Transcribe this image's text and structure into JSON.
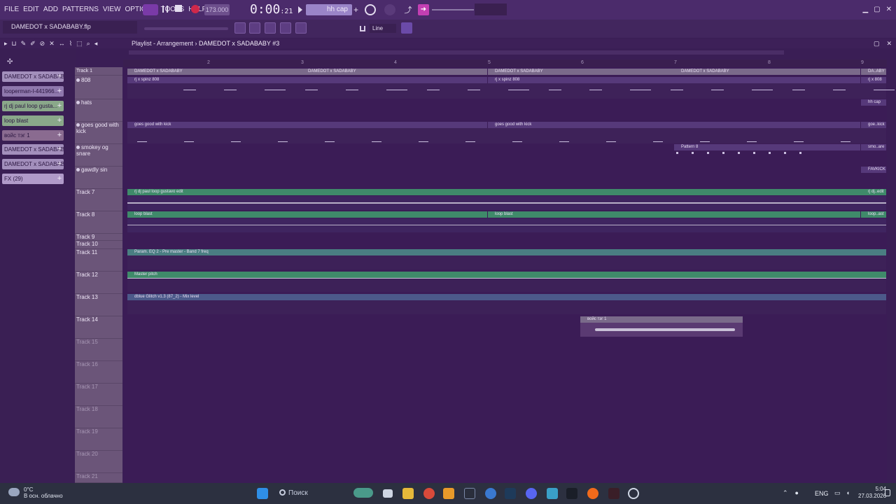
{
  "menu": [
    "FILE",
    "EDIT",
    "ADD",
    "PATTERNS",
    "VIEW",
    "OPTIONS",
    "TOOLS",
    "HELP"
  ],
  "transport": {
    "bpm": "173.000",
    "time_main": "0:00",
    "time_sub": "21",
    "pattern": "hh cap"
  },
  "hint_bar": "DAMEDOT x SADABABY.flp",
  "snap": "Line",
  "playlist": {
    "title": "Playlist - Arrangement",
    "arrangement": "DAMEDOT x SADABABY #3"
  },
  "ruler_marks": [
    "2",
    "3",
    "4",
    "5",
    "6",
    "7",
    "8",
    "9"
  ],
  "picker": [
    {
      "label": "DAMEDOT x SADABAB..",
      "color": "#a38fbc"
    },
    {
      "label": "looperman-l-441966...",
      "color": "#8f78ad"
    },
    {
      "label": "rj dj paul loop gusta...",
      "color": "#8aa88a"
    },
    {
      "label": "loop blast",
      "color": "#8aa88a"
    },
    {
      "label": "войс тэг 1",
      "color": "#8a6b90"
    },
    {
      "label": "DAMEDOT x SADABAB..",
      "color": "#a38fbc"
    },
    {
      "label": "DAMEDOT x SADABAB..",
      "color": "#a38fbc"
    },
    {
      "label": "FX (29)",
      "color": "#b09ac9"
    }
  ],
  "tracks": [
    {
      "label": "808",
      "dim": false
    },
    {
      "label": "hats",
      "dim": false
    },
    {
      "label": "goes good with kick",
      "dim": false
    },
    {
      "label": "smokey og snare",
      "dim": false
    },
    {
      "label": "gawdly sin",
      "dim": false
    },
    {
      "label": "Track 7",
      "dim": false
    },
    {
      "label": "Track 8",
      "dim": false
    },
    {
      "label": "Track 9",
      "dim": false
    },
    {
      "label": "Track 10",
      "dim": false
    },
    {
      "label": "Track 11",
      "dim": false
    },
    {
      "label": "Track 12",
      "dim": false
    },
    {
      "label": "Track 13",
      "dim": false
    },
    {
      "label": "Track 14",
      "dim": false
    },
    {
      "label": "Track 15",
      "dim": true
    },
    {
      "label": "Track 16",
      "dim": true
    },
    {
      "label": "Track 17",
      "dim": true
    },
    {
      "label": "Track 18",
      "dim": true
    },
    {
      "label": "Track 19",
      "dim": true
    },
    {
      "label": "Track 20",
      "dim": true
    },
    {
      "label": "Track 21",
      "dim": true
    }
  ],
  "track1_label": "Track 1",
  "clips": {
    "pattern": "DAMEDOT x SADABABY",
    "pattern_short": "DA..ABY",
    "spinz": "rj x spinz 808",
    "spinz_short": "rj x 808",
    "hihat": "hh cap",
    "kick": "goes good with kick",
    "kick_short": "goe..kick",
    "pattern8": "Pattern 8",
    "snare": "smo..are",
    "gawdly": "FAVKICK",
    "gustavo": "rj dj paul loop gustavo edit",
    "gustavo_short": "rj dj..edit",
    "loopblast": "loop blast",
    "loopblast_short": "loop..ast",
    "auto1": "Param. EQ 2 - Pre master - Band 7 freq",
    "auto2": "Master pitch",
    "auto3": "dblue Glitch v1.3 (87_2) - Mix level",
    "voicetag": "войс тэг 1"
  },
  "taskbar": {
    "weather_temp": "0°C",
    "weather_desc": "В осн. облачно",
    "search": "Поиск",
    "lang": "ENG",
    "time": "5:04",
    "date": "27.03.2026"
  },
  "colors": {
    "bg": "#3b1c56",
    "accent": "#7a3aa8",
    "record": "#d0284a"
  }
}
